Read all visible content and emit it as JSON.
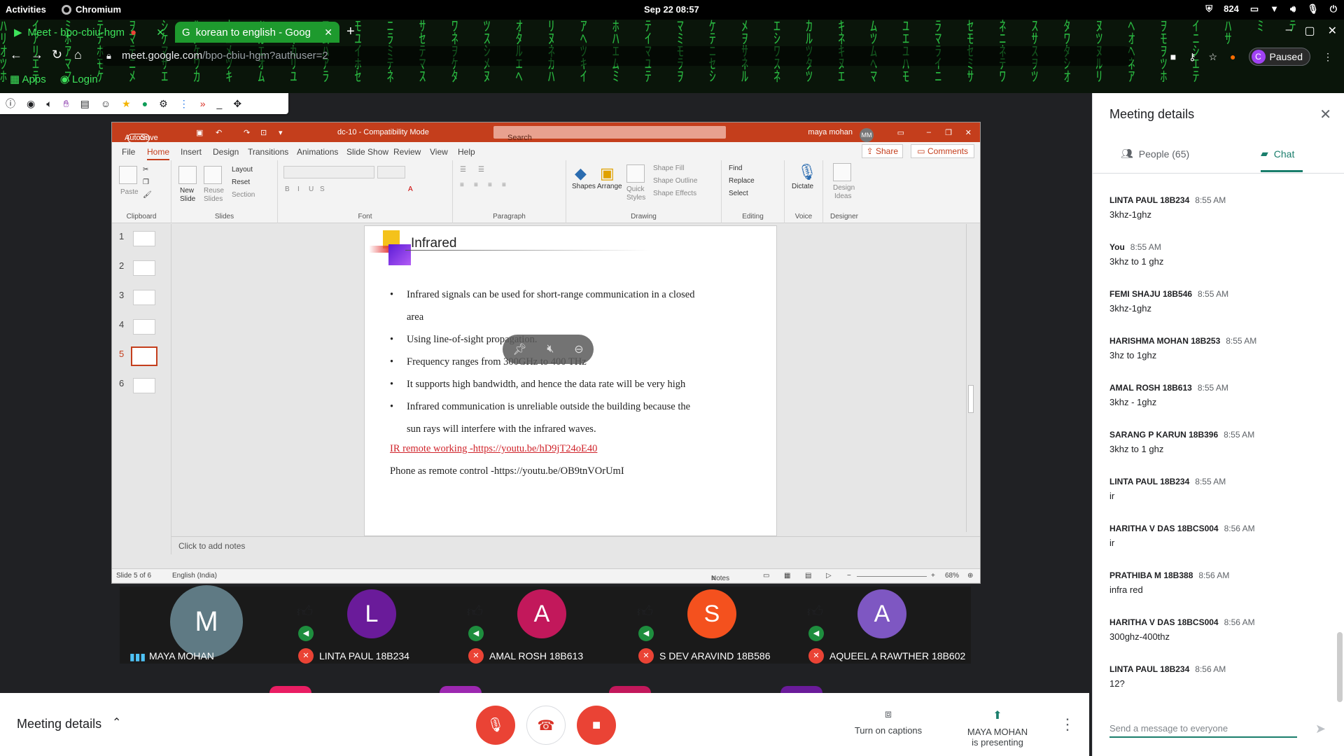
{
  "os": {
    "activities": "Activities",
    "app_name": "Chromium",
    "clock": "Sep 22  08:57",
    "tray_count": "824"
  },
  "browser": {
    "tabs": [
      {
        "label": "Meet - bpo-cbiu-hgm"
      },
      {
        "label": "korean to english - Goog"
      }
    ],
    "url_host": "meet.google.com",
    "url_path": "/bpo-cbiu-hgm?authuser=2",
    "profile_initial": "C",
    "profile_status": "Paused",
    "bookmarks": [
      {
        "label": "Apps"
      },
      {
        "label": "Login"
      }
    ]
  },
  "powerpoint": {
    "autosave_label": "AutoSave",
    "autosave_state": "Off",
    "doc_title": "dc-10 - Compatibility Mode",
    "search_placeholder": "Search",
    "user_name": "maya mohan",
    "user_initials": "MM",
    "ribbon_tabs": [
      "File",
      "Home",
      "Insert",
      "Design",
      "Transitions",
      "Animations",
      "Slide Show",
      "Review",
      "View",
      "Help"
    ],
    "share_label": "Share",
    "comments_label": "Comments",
    "ribbon": {
      "paste": "Paste",
      "clipboard": "Clipboard",
      "new_slide_1": "New",
      "new_slide_2": "Slide",
      "reuse_1": "Reuse",
      "reuse_2": "Slides",
      "layout": "Layout",
      "reset": "Reset",
      "section": "Section",
      "slides": "Slides",
      "font": "Font",
      "paragraph": "Paragraph",
      "shapes": "Shapes",
      "arrange": "Arrange",
      "quick_styles_1": "Quick",
      "quick_styles_2": "Styles",
      "shape_fill": "Shape Fill",
      "shape_outline": "Shape Outline",
      "shape_effects": "Shape Effects",
      "drawing": "Drawing",
      "find": "Find",
      "replace": "Replace",
      "select": "Select",
      "editing": "Editing",
      "dictate": "Dictate",
      "voice": "Voice",
      "design_ideas_1": "Design",
      "design_ideas_2": "Ideas",
      "designer": "Designer"
    },
    "thumbnails": [
      "1",
      "2",
      "3",
      "4",
      "5",
      "6"
    ],
    "slide": {
      "title": "Infrared",
      "bullets": [
        {
          "text": "Infrared signals can be used for short-range communication in a closed",
          "cont": "area"
        },
        {
          "text": "Using line-of-sight propagation."
        },
        {
          "text": "Frequency ranges from 300GHz to 400 THz"
        },
        {
          "text": "It supports high bandwidth, and hence the data rate will be very high"
        },
        {
          "text": "Infrared communication is unreliable outside the building because the",
          "cont": "sun rays will interfere with the infrared waves."
        }
      ],
      "link1": "IR remote working -https://youtu.be/hD9jT24oE40",
      "link2": "Phone as remote control -https://youtu.be/OB9tnVOrUmI"
    },
    "notes_placeholder": "Click to add notes",
    "status_slide": "Slide 5 of 6",
    "status_lang": "English (India)",
    "status_notes": "Notes",
    "zoom": "68%"
  },
  "participants": [
    {
      "initial": "M",
      "name": "MAYA MOHAN",
      "color": "#5f7a84"
    },
    {
      "initial": "L",
      "name": "LINTA PAUL 18B234",
      "color": "#6a1b9a"
    },
    {
      "initial": "A",
      "name": "AMAL ROSH 18B613",
      "color": "#c2185b"
    },
    {
      "initial": "S",
      "name": "S DEV ARAVIND 18B586",
      "color": "#f4511e"
    },
    {
      "initial": "A",
      "name": "AQUEEL A RAWTHER 18B602",
      "color": "#7e57c2"
    }
  ],
  "bottom_bar": {
    "meeting_details": "Meeting details",
    "captions": "Turn on captions",
    "presenting_name": "MAYA MOHAN",
    "presenting_status": "is presenting"
  },
  "panel": {
    "title": "Meeting details",
    "people_tab": "People (65)",
    "chat_tab": "Chat",
    "messages": [
      {
        "who": "LINTA PAUL 18B234",
        "time": "8:55 AM",
        "text": "3khz-1ghz"
      },
      {
        "who": "You",
        "time": "8:55 AM",
        "text": "3khz to 1 ghz"
      },
      {
        "who": "FEMI SHAJU 18B546",
        "time": "8:55 AM",
        "text": "3khz-1ghz"
      },
      {
        "who": "HARISHMA MOHAN 18B253",
        "time": "8:55 AM",
        "text": "3hz to 1ghz"
      },
      {
        "who": "AMAL ROSH 18B613",
        "time": "8:55 AM",
        "text": "3khz - 1ghz"
      },
      {
        "who": "SARANG P KARUN 18B396",
        "time": "8:55 AM",
        "text": "3khz to 1 ghz"
      },
      {
        "who": "LINTA PAUL 18B234",
        "time": "8:55 AM",
        "text": "ir"
      },
      {
        "who": "HARITHA V DAS 18BCS004",
        "time": "8:56 AM",
        "text": "ir"
      },
      {
        "who": "PRATHIBA M 18B388",
        "time": "8:56 AM",
        "text": "infra red"
      },
      {
        "who": "HARITHA V DAS 18BCS004",
        "time": "8:56 AM",
        "text": "300ghz-400thz"
      },
      {
        "who": "LINTA PAUL 18B234",
        "time": "8:56 AM",
        "text": "12?"
      }
    ],
    "compose_placeholder": "Send a message to everyone"
  }
}
